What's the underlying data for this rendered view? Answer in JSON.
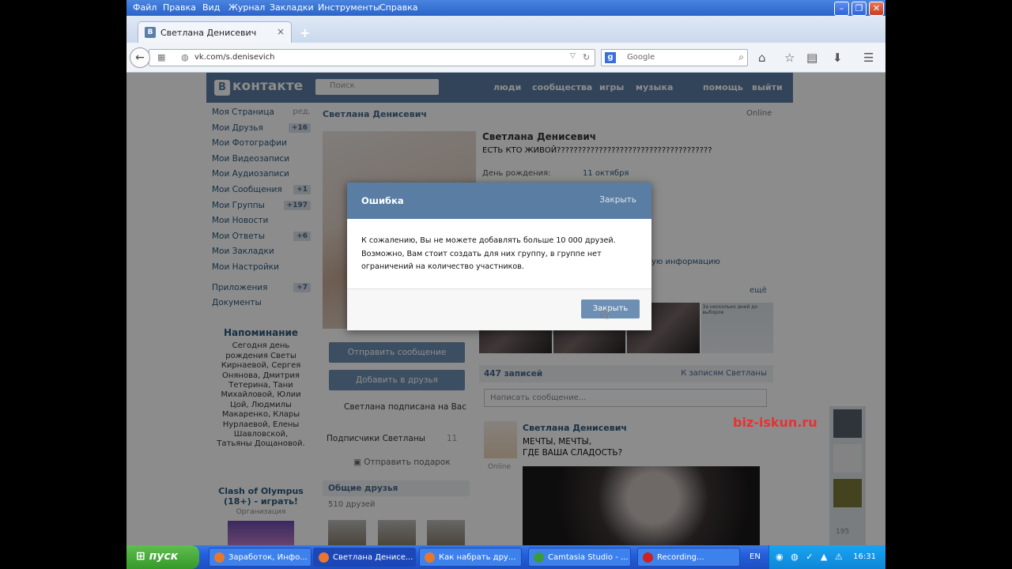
{
  "browser": {
    "menu": [
      "Файл",
      "Правка",
      "Вид",
      "Журнал",
      "Закладки",
      "Инструменты",
      "Справка"
    ],
    "tab_title": "Светлана Денисевич",
    "tab_icon_letter": "B",
    "tab_close": "×",
    "new_tab": "+",
    "url": "vk.com/s.denisevich",
    "search_placeholder": "Google",
    "search_engine_letter": "g"
  },
  "vk": {
    "logo": "контакте",
    "logo_badge": "B",
    "search_placeholder": "Поиск",
    "nav": [
      "люди",
      "сообщества",
      "игры",
      "музыка",
      "помощь",
      "выйти"
    ],
    "left_menu": [
      {
        "label": "Моя Страница",
        "extra": "ред."
      },
      {
        "label": "Мои Друзья",
        "count": "+16"
      },
      {
        "label": "Мои Фотографии",
        "count": ""
      },
      {
        "label": "Мои Видеозаписи",
        "count": ""
      },
      {
        "label": "Мои Аудиозаписи",
        "count": ""
      },
      {
        "label": "Мои Сообщения",
        "count": "+1"
      },
      {
        "label": "Мои Группы",
        "count": "+197"
      },
      {
        "label": "Мои Новости",
        "count": ""
      },
      {
        "label": "Мои Ответы",
        "count": "+6"
      },
      {
        "label": "Мои Закладки",
        "count": ""
      },
      {
        "label": "Мои Настройки",
        "count": ""
      },
      {
        "label": "Приложения",
        "count": "+7"
      },
      {
        "label": "Документы",
        "count": ""
      }
    ],
    "reminder_title": "Напоминание",
    "reminder_text": "Сегодня день рождения Светы Кирнаевой, Сергея Онянова, Дмитрия Тетерина, Тани Михайловой, Юлии Цой, Людмилы Макаренко, Клары Нурлаевой, Елены Шавловской, Татьяны Дощановой.",
    "ad_title": "Clash of Olympus (18+) - играть!",
    "ad_sub": "Организация",
    "column_header": "Светлана Денисевич",
    "online_label": "Online",
    "profile_name": "Светлана Денисевич",
    "profile_status": "ЕСТЬ КТО ЖИВОЙ?????????????????????????????????????",
    "birthday_label": "День рождения:",
    "birthday_value": "11 октября",
    "more_info": "ую информацию",
    "photos_all": "ещё",
    "photo_caption": "За несколько дней до выборов",
    "send_message": "Отправить сообщение",
    "add_friend": "Добавить в друзья",
    "subscribed": "Светлана подписана на Вас",
    "subscribers_label": "Подписчики Светланы",
    "subscribers_count": "11",
    "send_gift": "Отправить подарок",
    "gift_icon": "gift-icon",
    "common_friends": "Общие друзья",
    "common_friends_count": "510 друзей",
    "wall_count": "447 записей",
    "wall_filter": "К записям Светланы",
    "new_post_placeholder": "Написать сообщение...",
    "post_author": "Светлана Денисевич",
    "post_line1": "МЕЧТЫ, МЕЧТЫ,",
    "post_line2": "ГДЕ ВАША СЛАДОСТЬ?",
    "post_online": "Online",
    "side_count": "195",
    "watermark": "biz-iskun.ru"
  },
  "dialog": {
    "title": "Ошибка",
    "close_link": "Закрыть",
    "line1": "К сожалению, Вы не можете добавлять больше 10 000 друзей.",
    "line2": "Возможно, Вам стоит создать для них группу, в группе нет",
    "line3": "ограничений на количество участников.",
    "button": "Закрыть"
  },
  "taskbar": {
    "start": "пуск",
    "tasks": [
      "Заработок, Инфо...",
      "Светлана Денисе...",
      "Как набрать дру...",
      "Camtasia Studio - ...",
      "Recording..."
    ],
    "active_index": 1,
    "lang": "EN",
    "time": "16:31"
  },
  "colors": {
    "vk_blue": "#597da3",
    "button_blue": "#6d8fb3",
    "xp_taskbar": "#245edb",
    "start_green": "#3e9c32"
  }
}
